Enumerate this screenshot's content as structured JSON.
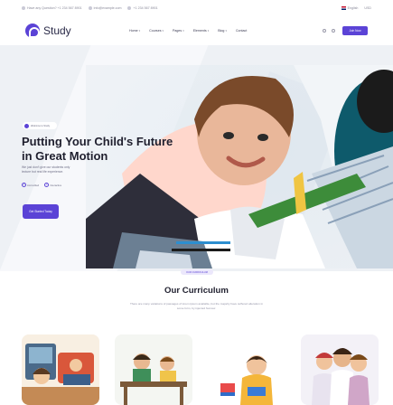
{
  "topbar": {
    "phone": "Have any Question? +1 234 567 8901",
    "email": "info@example.com",
    "phone2": "+1 234 567 8901",
    "language": "English",
    "currency": "USD"
  },
  "navbar": {
    "logo_text": "Study",
    "menu": [
      {
        "label": "Home"
      },
      {
        "label": "Courses"
      },
      {
        "label": "Pages"
      },
      {
        "label": "Elements"
      },
      {
        "label": "Blog"
      },
      {
        "label": "Contact"
      }
    ],
    "join_label": "Join Now"
  },
  "hero": {
    "badge_text": "Welcome to Study",
    "title": "Putting Your Child's Future in Great Motion",
    "description": "We just don't give our students only lecture but real life experience.",
    "checks": [
      "Accredited",
      "Interactive"
    ],
    "cta_label": "Get Started Today"
  },
  "curriculum": {
    "pill": "OUR CURRICULUM",
    "title": "Our Curriculum",
    "description": "There are many variations of passages of lorem ipsum available, but the majority have suffered alteration in some form, by injected humour."
  },
  "cards": [
    {
      "icon": "children-class-illustration"
    },
    {
      "icon": "students-desk-illustration"
    },
    {
      "icon": "kid-with-book-illustration"
    },
    {
      "icon": "friends-group-illustration"
    }
  ],
  "colors": {
    "accent": "#5b43d6",
    "hero_bg": "#eef1f5"
  }
}
